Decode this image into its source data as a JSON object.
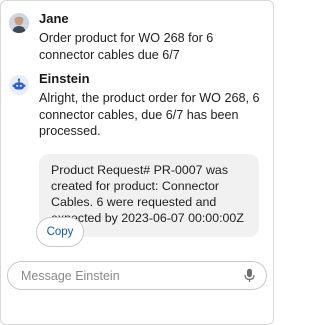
{
  "messages": {
    "user": {
      "name": "Jane",
      "text": "Order product for WO 268 for 6 connector cables due 6/7",
      "avatar_icon": "user-photo-avatar"
    },
    "bot": {
      "name": "Einstein",
      "text": "Alright, the product order for WO 268, 6 connector cables, due 6/7 has been processed.",
      "card_text": "Product Request# PR-0007 was created for product: Connector Cables. 6 were requested and expected by 2023-06-07 00:00:00Z",
      "avatar_icon": "einstein-bot-icon"
    }
  },
  "actions": {
    "copy_label": "Copy"
  },
  "composer": {
    "placeholder": "Message Einstein",
    "mic_icon": "microphone-icon"
  },
  "colors": {
    "accent": "#0b5cab",
    "bot_icon": "#2d5bd3",
    "card_bg": "#f1f1f2",
    "border": "#c9c9c9"
  }
}
